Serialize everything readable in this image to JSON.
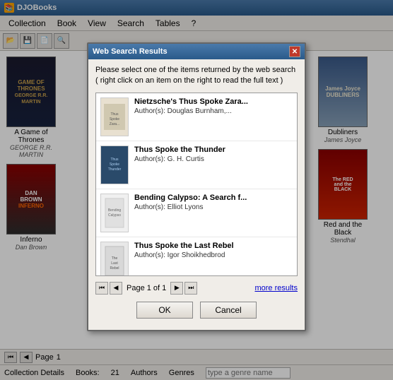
{
  "app": {
    "title": "DJOBooks",
    "icon": "📚"
  },
  "menubar": {
    "items": [
      "Collection",
      "Book",
      "View",
      "Search",
      "Tables",
      "?"
    ]
  },
  "booksLeft": [
    {
      "title": "A Game of Thrones",
      "author": "George R. R. Martin",
      "shortTitle": "GAME OF THRONES",
      "shortAuthor": "GEORGE R.R. MARTIN"
    },
    {
      "title": "Inferno",
      "author": "Dan Brown",
      "shortTitle": "DAN BROWN INFERNO",
      "shortAuthor": "Dan Brown"
    }
  ],
  "booksRight": [
    {
      "title": "Dubliners",
      "author": "James Joyce",
      "shortTitle": "James Joyce DUBLINERS"
    },
    {
      "title": "Red and the Black",
      "author": "Stendhal",
      "shortTitle": "The RED and the BLACK"
    }
  ],
  "dialog": {
    "title": "Web Search Results",
    "description_line1": "Please select one of the items returned by the web search",
    "description_line2": "( right click on an item on the right to read the full text )",
    "results": [
      {
        "title": "Nietzsche's Thus Spoke Zara...",
        "author": "Author(s): Douglas Burnham,...",
        "thumbType": "nietzsche"
      },
      {
        "title": "Thus Spoke the Thunder",
        "author": "Author(s): G. H. Curtis",
        "thumbType": "thunder"
      },
      {
        "title": "Bending Calypso: A Search f...",
        "author": "Author(s): Elliot Lyons",
        "thumbType": "calypso"
      },
      {
        "title": "Thus Spoke the Last Rebel",
        "author": "Author(s): Igor Shoikhedbrod",
        "thumbType": "rebel"
      }
    ],
    "pagination": {
      "page_info": "Page  1 of 1",
      "more_results": "more results"
    },
    "buttons": {
      "ok": "OK",
      "cancel": "Cancel"
    }
  },
  "statusBar": {
    "collection_detail": "Collection Details",
    "books_label": "Books:",
    "books_count": "21",
    "authors_label": "Authors",
    "genres_label": "Genres",
    "genre_placeholder": "type a genre name"
  },
  "bottomNav": {
    "page_label": "Page",
    "page_number": "1"
  }
}
